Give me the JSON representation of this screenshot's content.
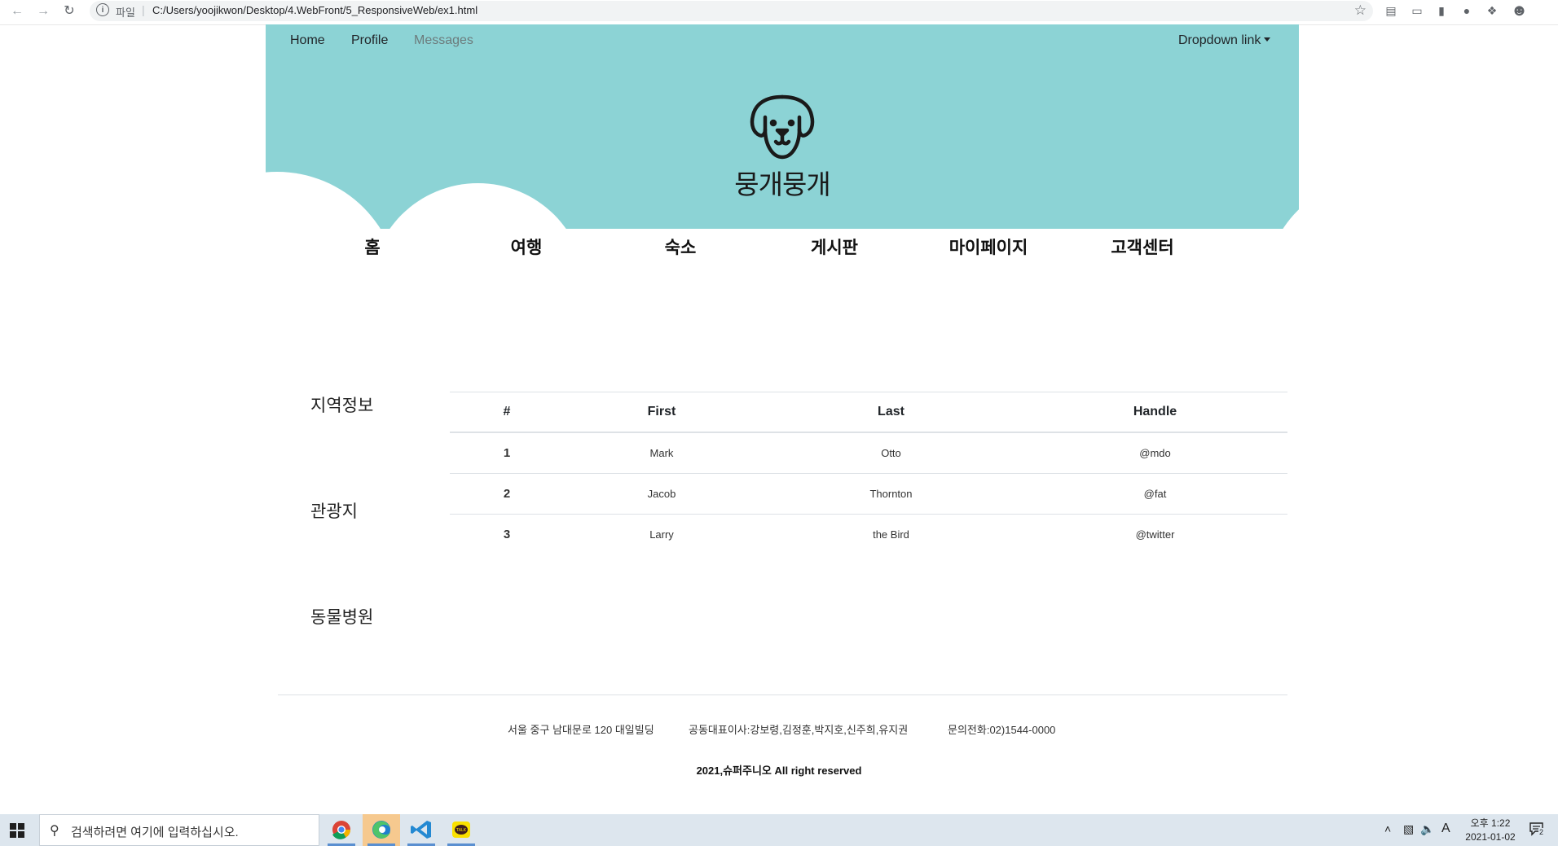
{
  "browser": {
    "scheme_label": "파일",
    "url": "C:/Users/yoojikwon/Desktop/4.WebFront/5_ResponsiveWeb/ex1.html"
  },
  "topnav": {
    "home": "Home",
    "profile": "Profile",
    "messages": "Messages",
    "dropdown": "Dropdown link"
  },
  "brand": {
    "name": "뭉개뭉개",
    "logo_icon": "dog-face-icon"
  },
  "mainmenu": [
    "홈",
    "여행",
    "숙소",
    "게시판",
    "마이페이지",
    "고객센터"
  ],
  "sidebar": [
    "지역정보",
    "관광지",
    "동물병원"
  ],
  "table": {
    "headers": [
      "#",
      "First",
      "Last",
      "Handle"
    ],
    "rows": [
      [
        "1",
        "Mark",
        "Otto",
        "@mdo"
      ],
      [
        "2",
        "Jacob",
        "Thornton",
        "@fat"
      ],
      [
        "3",
        "Larry",
        "the Bird",
        "@twitter"
      ]
    ]
  },
  "footer": {
    "address": "서울 중구 남대문로 120 대일빌딩",
    "ceo": "공동대표이사:강보령,김정훈,박지호,신주희,유지권",
    "phone": "문의전화:02)1544-0000",
    "copyright": "2021,슈퍼주니오 All right reserved"
  },
  "taskbar": {
    "search_placeholder": "검색하려면 여기에 입력하십시오.",
    "time": "오후 1:22",
    "date": "2021-01-02",
    "ime": "A",
    "notification_count": "2"
  },
  "colors": {
    "header_bg": "#8cd3d5",
    "accent": "#5a8fd0"
  }
}
